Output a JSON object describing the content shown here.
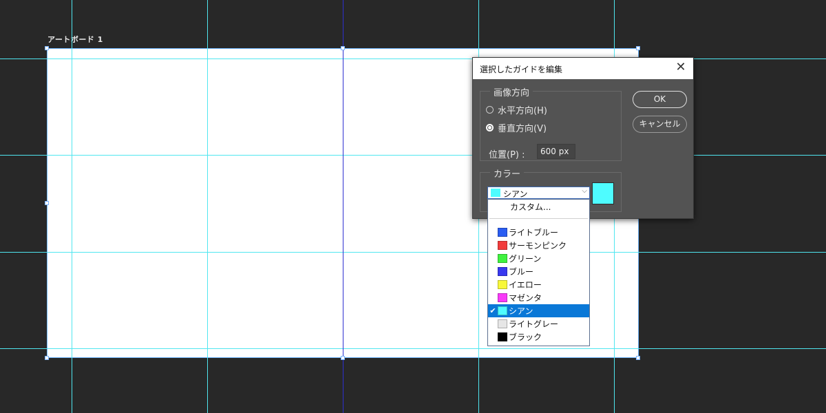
{
  "artboard": {
    "label": "アートボード 1"
  },
  "dialog": {
    "title": "選択したガイドを編集",
    "close_icon": "✕",
    "orientation_legend": "画像方向",
    "radio_horizontal": "水平方向(H)",
    "radio_vertical": "垂直方向(V)",
    "selected_orientation": "vertical",
    "position_label": "位置(P) :",
    "position_value": "600 px",
    "color_legend": "カラー",
    "ok_label": "OK",
    "cancel_label": "キャンセル",
    "selected_color": {
      "name": "シアン",
      "hex": "#4efcff"
    },
    "dropdown_arrow": "⌵"
  },
  "dropdown": {
    "custom_label": "カスタム...",
    "items": [
      {
        "label": "ライトブルー",
        "hex": "#2a5df2"
      },
      {
        "label": "サーモンピンク",
        "hex": "#f23c3c"
      },
      {
        "label": "グリーン",
        "hex": "#3ff23f"
      },
      {
        "label": "ブルー",
        "hex": "#3838f0"
      },
      {
        "label": "イエロー",
        "hex": "#f8f83a"
      },
      {
        "label": "マゼンタ",
        "hex": "#f83af8"
      },
      {
        "label": "シアン",
        "hex": "#4efcff",
        "selected": true
      },
      {
        "label": "ライトグレー",
        "hex": "#e6e6e6"
      },
      {
        "label": "ブラック",
        "hex": "#000000"
      }
    ],
    "check_icon": "✔"
  },
  "colors": {
    "guide": "#4fe6f0",
    "selected_guide": "#2d2fd0",
    "canvas_bg": "#282828",
    "dialog_bg": "#535353",
    "selection_highlight": "#0a78d7"
  }
}
